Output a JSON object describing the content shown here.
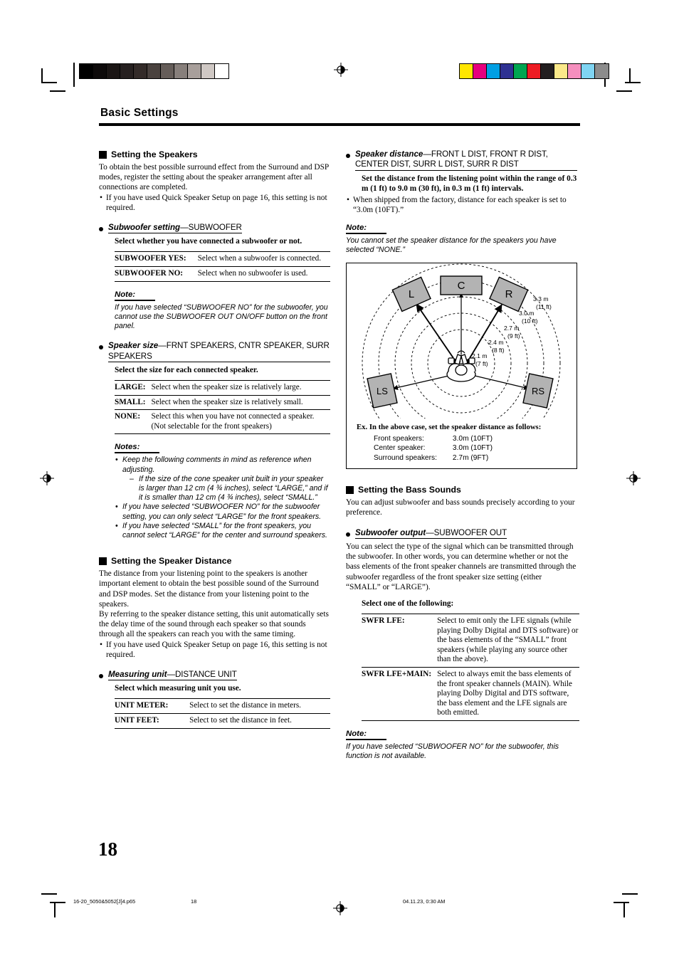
{
  "header": {
    "title": "Basic Settings"
  },
  "marks": {
    "gray_bar": [
      "#000000",
      "#0d0a0a",
      "#1a1514",
      "#262020",
      "#332b29",
      "#4a423f",
      "#655d59",
      "#877f7b",
      "#a89f9b",
      "#cfc8c4",
      "#ffffff"
    ],
    "color_bar": [
      "#ffe600",
      "#e6007e",
      "#009fe3",
      "#2e3192",
      "#00a551",
      "#ed1c24",
      "#231f20",
      "#fbe98a",
      "#f58fbe",
      "#7fd4f2",
      "#8c8c8c"
    ]
  },
  "left_column": {
    "section1": {
      "heading": "Setting the Speakers",
      "intro": "To obtain the best possible surround effect from the Surround and DSP modes, register the setting about the speaker arrangement after all connections are completed.",
      "bullets": [
        "If you have used Quick Speaker Setup on page 16, this setting is not required."
      ],
      "option1": {
        "title_bold": "Subwoofer setting",
        "title_code": "—SUBWOOFER",
        "lead": "Select whether you have connected a subwoofer or not.",
        "rows": [
          {
            "key": "SUBWOOFER YES:",
            "value": "Select when a subwoofer is connected."
          },
          {
            "key": "SUBWOOFER NO:",
            "value": "Select when no subwoofer is used."
          }
        ],
        "note_heading": "Note:",
        "note_text": "If you have selected “SUBWOOFER NO” for the subwoofer, you cannot use the SUBWOOFER OUT ON/OFF button on the front panel."
      },
      "option2": {
        "title_bold": "Speaker size",
        "title_code": "—FRNT SPEAKERS, CNTR SPEAKER, SURR SPEAKERS",
        "lead": "Select the size for each connected speaker.",
        "rows": [
          {
            "key": "LARGE:",
            "value": "Select when the speaker size is relatively large."
          },
          {
            "key": "SMALL:",
            "value": "Select when the speaker size is relatively small."
          },
          {
            "key": "NONE:",
            "value": "Select this when you have not connected a speaker. (Not selectable for the front speakers)"
          }
        ],
        "notes_heading": "Notes:",
        "notes": [
          "Keep the following comments in mind as reference when adjusting.",
          "If you have selected “SUBWOOFER NO” for the subwoofer setting, you can only select “LARGE” for the front speakers.",
          "If you have selected “SMALL” for the front speakers, you cannot select “LARGE” for the center and surround speakers."
        ],
        "sub_note": "If the size of the cone speaker unit built in your speaker is larger than 12 cm (4 ¾ inches), select “LARGE,” and if it is smaller than 12 cm (4 ¾ inches), select “SMALL.”"
      }
    },
    "section2": {
      "heading": "Setting the Speaker Distance",
      "intro1": "The distance from your listening point to the speakers is another important element to obtain the best possible sound of the Surround and DSP modes. Set the distance from your listening point to the speakers.",
      "intro2": "By referring to the speaker distance setting, this unit automatically sets the delay time of the sound through each speaker so that sounds through all the speakers can reach you with the same timing.",
      "bullets": [
        "If you have used Quick Speaker Setup on page 16, this setting is not required."
      ],
      "option1": {
        "title_bold": "Measuring unit",
        "title_code": "—DISTANCE UNIT",
        "lead": "Select which measuring unit you use.",
        "rows": [
          {
            "key": "UNIT METER:",
            "value": "Select to set the distance in meters."
          },
          {
            "key": "UNIT FEET:",
            "value": "Select to set the distance in feet."
          }
        ]
      }
    }
  },
  "right_column": {
    "option_distance": {
      "title_bold": "Speaker distance",
      "title_code": "—FRONT L DIST, FRONT R DIST, CENTER DIST, SURR L DIST, SURR R DIST",
      "lead": "Set the distance from the listening point within the range of 0.3 m (1 ft) to 9.0 m (30 ft), in 0.3 m (1 ft) intervals.",
      "bullets": [
        "When shipped from the factory, distance for each speaker is set to “3.0m (10FT).”"
      ],
      "note_heading": "Note:",
      "note_text": "You cannot set the speaker distance for the speakers you have selected “NONE.”"
    },
    "figure": {
      "speaker_labels": {
        "front_left": "L",
        "center": "C",
        "front_right": "R",
        "surround_left": "LS",
        "surround_right": "RS"
      },
      "arc_labels": [
        {
          "m": "3.3 m",
          "ft": "(11 ft)"
        },
        {
          "m": "3.0 m",
          "ft": "(10 ft)"
        },
        {
          "m": "2.7 m",
          "ft": "(9 ft)"
        },
        {
          "m": "2.4 m",
          "ft": "(8 ft)"
        },
        {
          "m": "2.1 m",
          "ft": "(7 ft)"
        }
      ],
      "example_title": "Ex. In the above case, set the speaker distance as follows:",
      "example_rows": [
        {
          "label": "Front speakers:",
          "value": "3.0m (10FT)"
        },
        {
          "label": "Center speaker:",
          "value": "3.0m (10FT)"
        },
        {
          "label": "Surround speakers:",
          "value": "2.7m (9FT)"
        }
      ]
    },
    "section3": {
      "heading": "Setting the Bass Sounds",
      "intro": "You can adjust subwoofer and bass sounds precisely according to your preference.",
      "option1": {
        "title_bold": "Subwoofer output",
        "title_code": "—SUBWOOFER OUT",
        "body": "You can select the type of the signal which can be transmitted through the subwoofer. In other words, you can determine whether or not the bass elements of the front speaker channels are transmitted through the subwoofer regardless of the front speaker size setting (either “SMALL” or “LARGE”).",
        "lead": "Select one of the following:",
        "rows": [
          {
            "key": "SWFR LFE:",
            "value": "Select to emit only the LFE signals (while playing Dolby Digital and DTS software) or the bass elements of the “SMALL” front speakers (while playing any source other than the above)."
          },
          {
            "key": "SWFR LFE+MAIN:",
            "value": "Select to always emit the bass elements of the front speaker channels (MAIN). While playing Dolby Digital and DTS software, the bass element and the LFE signals are both emitted."
          }
        ],
        "note_heading": "Note:",
        "note_text": "If you have selected “SUBWOOFER NO” for the subwoofer, this function is not available."
      }
    }
  },
  "page_number": "18",
  "footer": {
    "filename": "16-20_5050&5052[J]4.p65",
    "page": "18",
    "timestamp": "04.11.23, 0:30 AM"
  }
}
